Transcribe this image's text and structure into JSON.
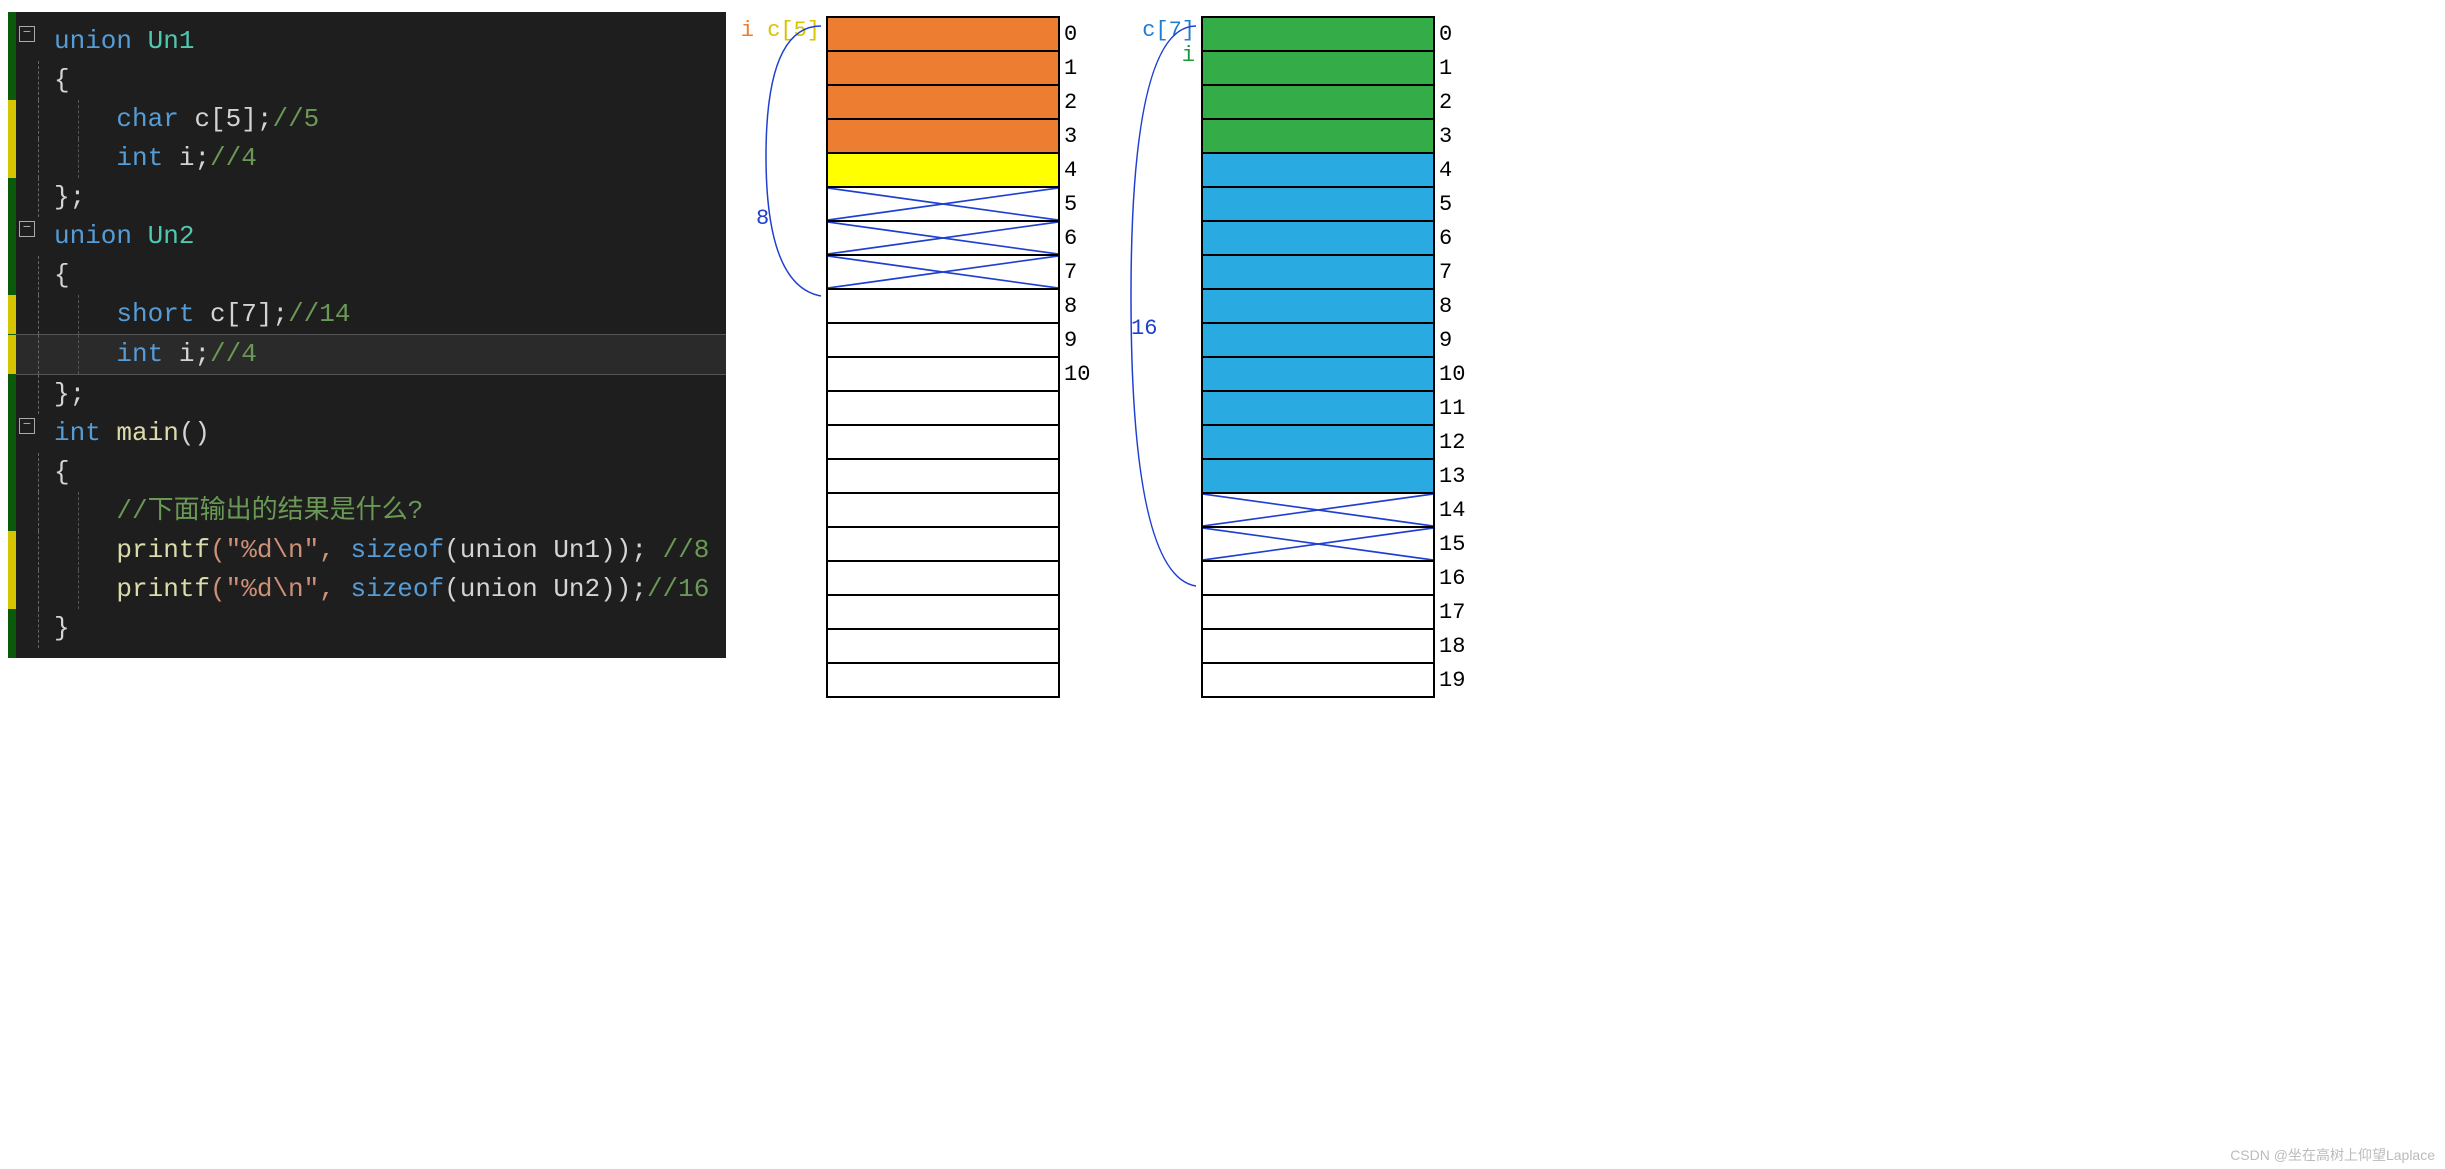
{
  "code": {
    "un1_decl": "union",
    "un1_name": " Un1",
    "brace_open": "{",
    "brace_close": "};",
    "char_kw": "char",
    "c5": " c[5];",
    "c5_comment": "//5",
    "int_kw": "int",
    "i_decl": " i;",
    "i_comment": "//4",
    "un2_name": " Un2",
    "short_kw": "short",
    "c7": " c[7];",
    "c7_comment": "//14",
    "main_ret": "int",
    "main_name": " main",
    "main_paren": "()",
    "main_brace_open": "{",
    "main_brace_close": "}",
    "comment_q": "//下面输出的结果是什么?",
    "printf": "printf",
    "fmt": "(\"%d\\n\", ",
    "sizeof": "sizeof",
    "un1_arg": "(union Un1)); ",
    "un1_res": "//8",
    "un2_arg": "(union Un2));",
    "un2_res": "//16"
  },
  "diagram1": {
    "label_i": "i",
    "label_c": "c[5]",
    "size": "8",
    "indices": [
      "0",
      "1",
      "2",
      "3",
      "4",
      "5",
      "6",
      "7",
      "8",
      "9",
      "10"
    ],
    "total_rows": 20,
    "orange_rows": [
      0,
      1,
      2,
      3
    ],
    "yellow_rows": [
      4
    ],
    "cross_rows": [
      5,
      6,
      7
    ]
  },
  "diagram2": {
    "label_c": "c[7]",
    "label_i": "i",
    "size": "16",
    "indices": [
      "0",
      "1",
      "2",
      "3",
      "4",
      "5",
      "6",
      "7",
      "8",
      "9",
      "10",
      "11",
      "12",
      "13",
      "14",
      "15",
      "16",
      "17",
      "18",
      "19"
    ],
    "total_rows": 20,
    "green_rows": [
      0,
      1,
      2,
      3
    ],
    "blue_rows": [
      4,
      5,
      6,
      7,
      8,
      9,
      10,
      11,
      12,
      13
    ],
    "cross_rows": [
      14,
      15
    ]
  },
  "watermark": "CSDN @坐在高树上仰望Laplace"
}
